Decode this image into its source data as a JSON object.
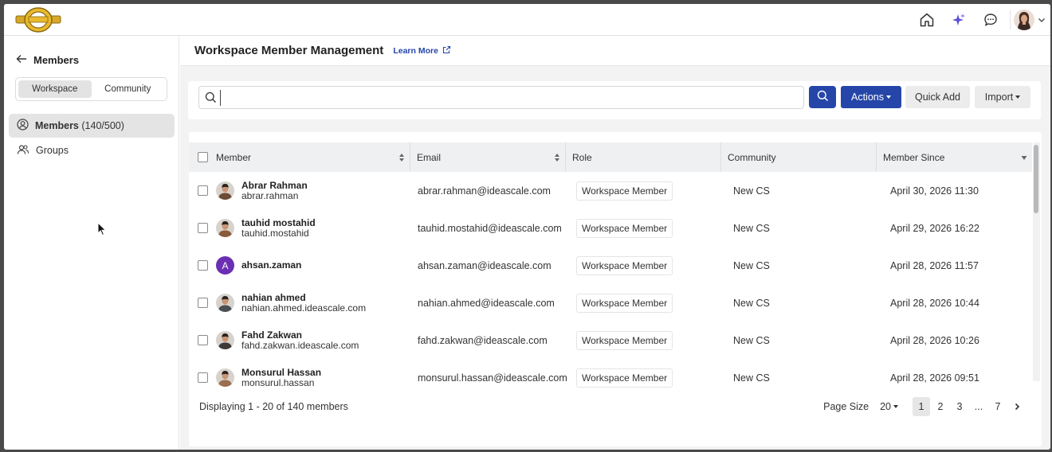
{
  "app": {
    "logo_name": "brand-logo",
    "accent": "#2546a8"
  },
  "topbar": {
    "icons": [
      "home-icon",
      "sparkle-icon",
      "chat-icon",
      "user-avatar",
      "chevron-down-icon"
    ]
  },
  "sidebar": {
    "back_label": "Members",
    "segment": {
      "workspace": "Workspace",
      "community": "Community",
      "selected": "Workspace"
    },
    "items": [
      {
        "label": "Members",
        "count": "(140/500)",
        "active": true,
        "icon": "user-circle-icon"
      },
      {
        "label": "Groups",
        "count": "",
        "active": false,
        "icon": "users-icon"
      }
    ]
  },
  "header": {
    "title": "Workspace Member Management",
    "learn_more": "Learn More"
  },
  "toolbar": {
    "search_placeholder": "",
    "actions_label": "Actions",
    "quick_add_label": "Quick Add",
    "import_label": "Import"
  },
  "table": {
    "columns": [
      "Member",
      "Email",
      "Role",
      "Community",
      "Member Since"
    ],
    "rows": [
      {
        "name": "Abrar Rahman",
        "username": "abrar.rahman",
        "email": "abrar.rahman@ideascale.com",
        "role": "Workspace Member",
        "community": "New CS",
        "since": "April 30, 2026 11:30",
        "avatar": "photo",
        "avatar_color": "#6b4b34"
      },
      {
        "name": "tauhid mostahid",
        "username": "tauhid.mostahid",
        "email": "tauhid.mostahid@ideascale.com",
        "role": "Workspace Member",
        "community": "New CS",
        "since": "April 29, 2026 16:22",
        "avatar": "photo",
        "avatar_color": "#8a5a3c"
      },
      {
        "name": "ahsan.zaman",
        "username": "",
        "email": "ahsan.zaman@ideascale.com",
        "role": "Workspace Member",
        "community": "New CS",
        "since": "April 28, 2026 11:57",
        "avatar": "letter",
        "avatar_letter": "A",
        "avatar_color": "#6b2fb3"
      },
      {
        "name": "nahian ahmed",
        "username": "nahian.ahmed.ideascale.com",
        "email": "nahian.ahmed@ideascale.com",
        "role": "Workspace Member",
        "community": "New CS",
        "since": "April 28, 2026 10:44",
        "avatar": "photo",
        "avatar_color": "#4b4f52"
      },
      {
        "name": "Fahd Zakwan",
        "username": "fahd.zakwan.ideascale.com",
        "email": "fahd.zakwan@ideascale.com",
        "role": "Workspace Member",
        "community": "New CS",
        "since": "April 28, 2026 10:26",
        "avatar": "photo",
        "avatar_color": "#3d3a38"
      },
      {
        "name": "Monsurul Hassan",
        "username": "monsurul.hassan",
        "email": "monsurul.hassan@ideascale.com",
        "role": "Workspace Member",
        "community": "New CS",
        "since": "April 28, 2026 09:51",
        "avatar": "photo",
        "avatar_color": "#9a6e50"
      }
    ]
  },
  "footer": {
    "displaying": "Displaying 1 - 20 of 140 members",
    "page_size_label": "Page Size",
    "page_size_value": "20",
    "pages": [
      "1",
      "2",
      "3",
      "...",
      "7"
    ],
    "current_page": "1"
  }
}
